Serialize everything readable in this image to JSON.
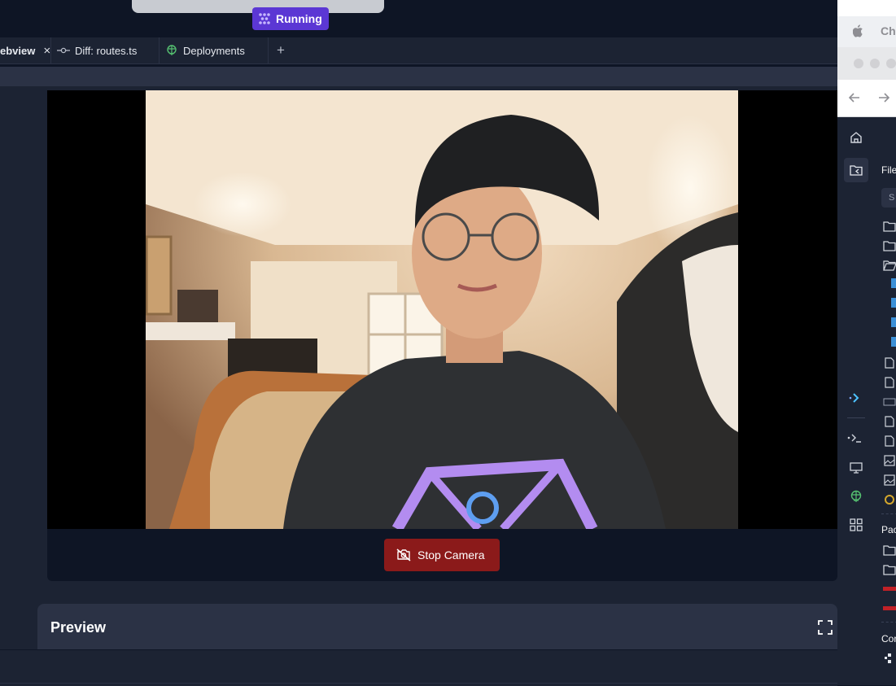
{
  "run_status": {
    "label": "Running"
  },
  "tabs": [
    {
      "label": "ebview",
      "icon": "close-icon"
    },
    {
      "label": "Diff: routes.ts",
      "icon": "git-commit-icon"
    },
    {
      "label": "Deployments",
      "icon": "deployments-icon"
    }
  ],
  "tab_add": "+",
  "camera": {
    "stop_label": "Stop Camera"
  },
  "preview": {
    "title": "Preview"
  },
  "chrome": {
    "tab_fragment": "Chr"
  },
  "filetree": {
    "files_header": "File",
    "search_fragment": "S",
    "packages_header": "Pac",
    "config_header": "Cor"
  },
  "colors": {
    "accent": "#5b37d4",
    "danger": "#8b1a1a",
    "bg": "#0e1525",
    "panel": "#1c2333"
  }
}
